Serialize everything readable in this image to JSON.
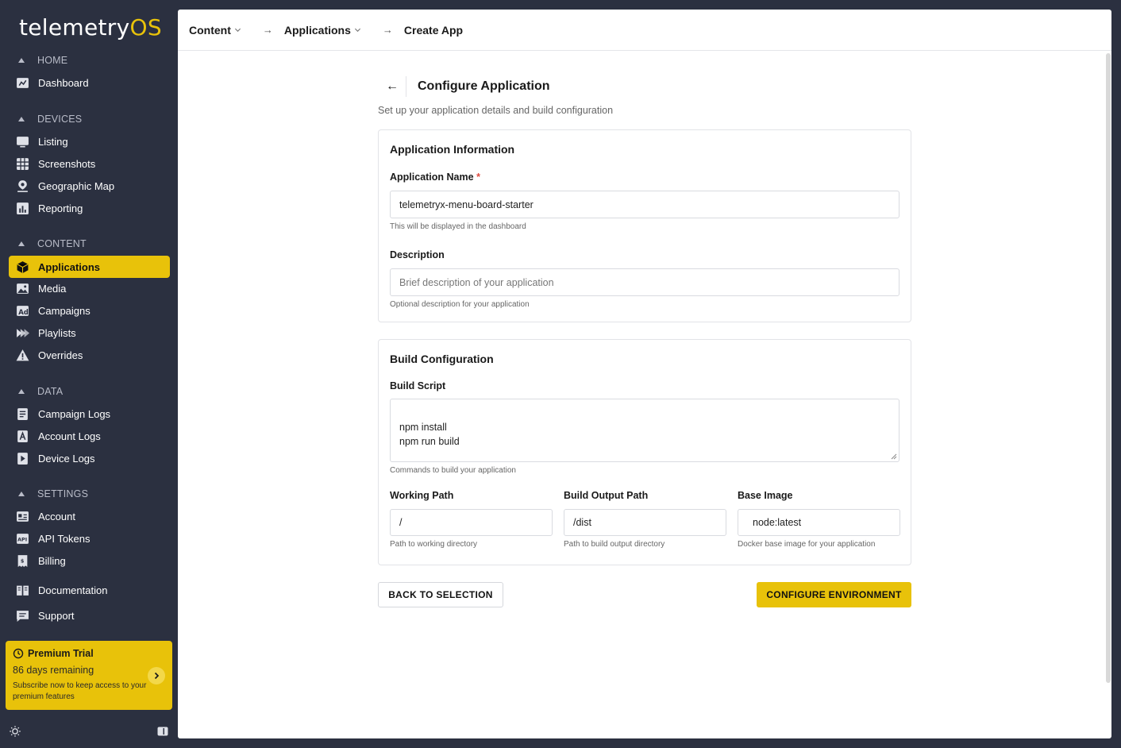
{
  "brand": {
    "name_main": "telemetry",
    "name_accent": "OS",
    "accent_color": "#e8c20a"
  },
  "sidebar": {
    "sections": {
      "home": "HOME",
      "devices": "DEVICES",
      "content": "CONTENT",
      "data": "DATA",
      "settings": "SETTINGS"
    },
    "items": {
      "dashboard": "Dashboard",
      "listing": "Listing",
      "screenshots": "Screenshots",
      "geographic_map": "Geographic Map",
      "reporting": "Reporting",
      "applications": "Applications",
      "media": "Media",
      "campaigns": "Campaigns",
      "playlists": "Playlists",
      "overrides": "Overrides",
      "campaign_logs": "Campaign Logs",
      "account_logs": "Account Logs",
      "device_logs": "Device Logs",
      "account": "Account",
      "api_tokens": "API Tokens",
      "billing": "Billing",
      "documentation": "Documentation",
      "support": "Support"
    },
    "active": "applications",
    "trial": {
      "title": "Premium Trial",
      "days": "86 days remaining",
      "desc": "Subscribe now to keep access to your premium features"
    }
  },
  "breadcrumb": {
    "content": "Content",
    "applications": "Applications",
    "current": "Create App"
  },
  "page": {
    "title": "Configure Application",
    "subtitle": "Set up your application details and build configuration"
  },
  "app_info": {
    "title": "Application Information",
    "name_label": "Application Name",
    "required_mark": "*",
    "name_value": "telemetryx-menu-board-starter",
    "name_hint": "This will be displayed in the dashboard",
    "desc_label": "Description",
    "desc_placeholder": "Brief description of your application",
    "desc_hint": "Optional description for your application"
  },
  "build": {
    "title": "Build Configuration",
    "script_label": "Build Script",
    "script_value": "npm install\nnpm run build",
    "script_hint": "Commands to build your application",
    "working_label": "Working Path",
    "working_value": "/",
    "working_hint": "Path to working directory",
    "output_label": "Build Output Path",
    "output_value": "/dist",
    "output_hint": "Path to build output directory",
    "image_label": "Base Image",
    "image_value": "node:latest",
    "image_hint": "Docker base image for your application"
  },
  "actions": {
    "back": "BACK TO SELECTION",
    "next": "CONFIGURE ENVIRONMENT"
  }
}
